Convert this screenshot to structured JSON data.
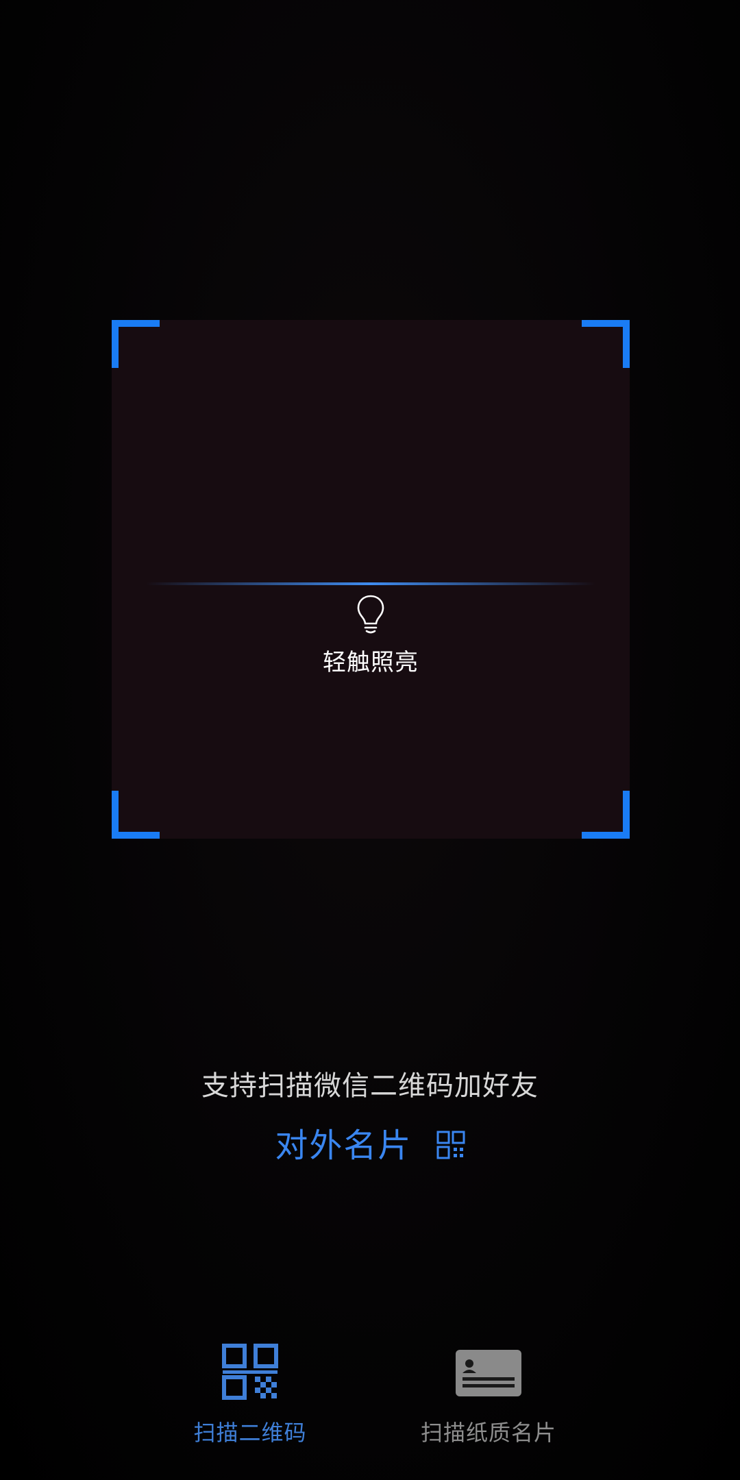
{
  "scanner": {
    "flash_label": "轻触照亮"
  },
  "hint": {
    "text": "支持扫描微信二维码加好友",
    "card_link": "对外名片"
  },
  "tabs": [
    {
      "label": "扫描二维码",
      "icon": "qr-code-icon",
      "selected": true
    },
    {
      "label": "扫描纸质名片",
      "icon": "business-card-icon",
      "selected": false
    }
  ],
  "colors": {
    "accent": "#1a7cf4",
    "link": "#3a86f0",
    "tab_selected": "#3f7fd8",
    "tab_unselected": "#8e8e8e"
  }
}
